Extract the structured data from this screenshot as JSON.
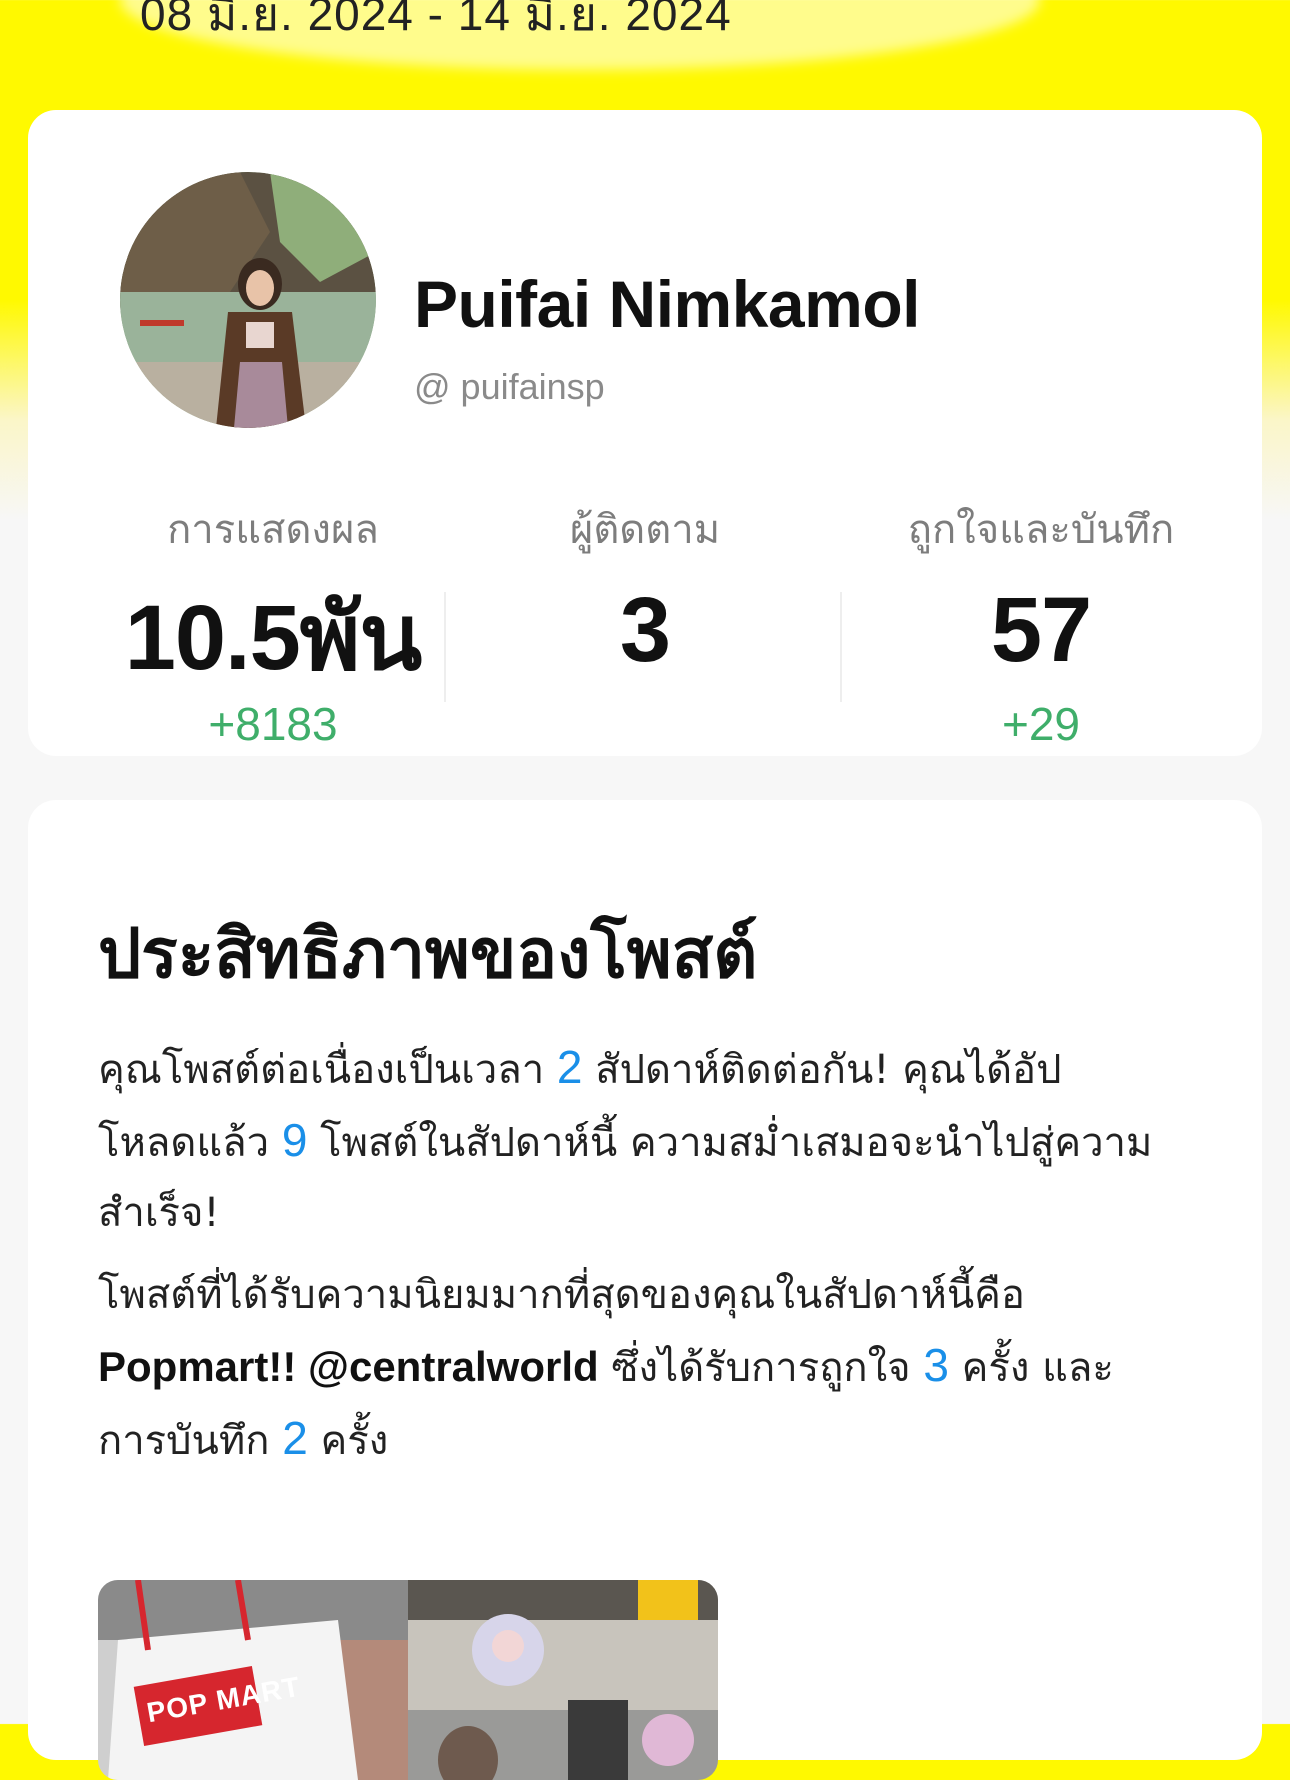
{
  "header": {
    "date_range": "08 มิ.ย. 2024 - 14 มิ.ย. 2024"
  },
  "profile": {
    "display_name": "Puifai Nimkamol",
    "handle": "@ puifainsp",
    "stats": [
      {
        "label": "การแสดงผล",
        "value": "10.5พัน",
        "delta": "+8183"
      },
      {
        "label": "ผู้ติดตาม",
        "value": "3",
        "delta": ""
      },
      {
        "label": "ถูกใจและบันทึก",
        "value": "57",
        "delta": "+29"
      }
    ]
  },
  "posts_section": {
    "title": "ประสิทธิภาพของโพสต์",
    "streak": {
      "t1": "คุณโพสต์ต่อเนื่องเป็นเวลา ",
      "weeks": "2",
      "t2": " สัปดาห์ติดต่อกัน! คุณได้อัปโหลดแล้ว ",
      "posts": "9",
      "t3": " โพสต์ในสัปดาห์นี้ ความสม่ำเสมอจะนำไปสู่ความสำเร็จ!"
    },
    "top_post": {
      "t1": "โพสต์ที่ได้รับความนิยมมากที่สุดของคุณในสัปดาห์นี้คือ ",
      "post_name": "Popmart!! @centralworld",
      "t2": " ซึ่งได้รับการถูกใจ ",
      "likes": "3",
      "t3": " ครั้ง และการบันทึก ",
      "saves": "2",
      "t4": " ครั้ง"
    },
    "thumbnail_text": "POP MART"
  },
  "colors": {
    "highlight_blue": "#1a8fe8",
    "delta_green": "#3fae6a",
    "header_yellow": "#fff900"
  }
}
